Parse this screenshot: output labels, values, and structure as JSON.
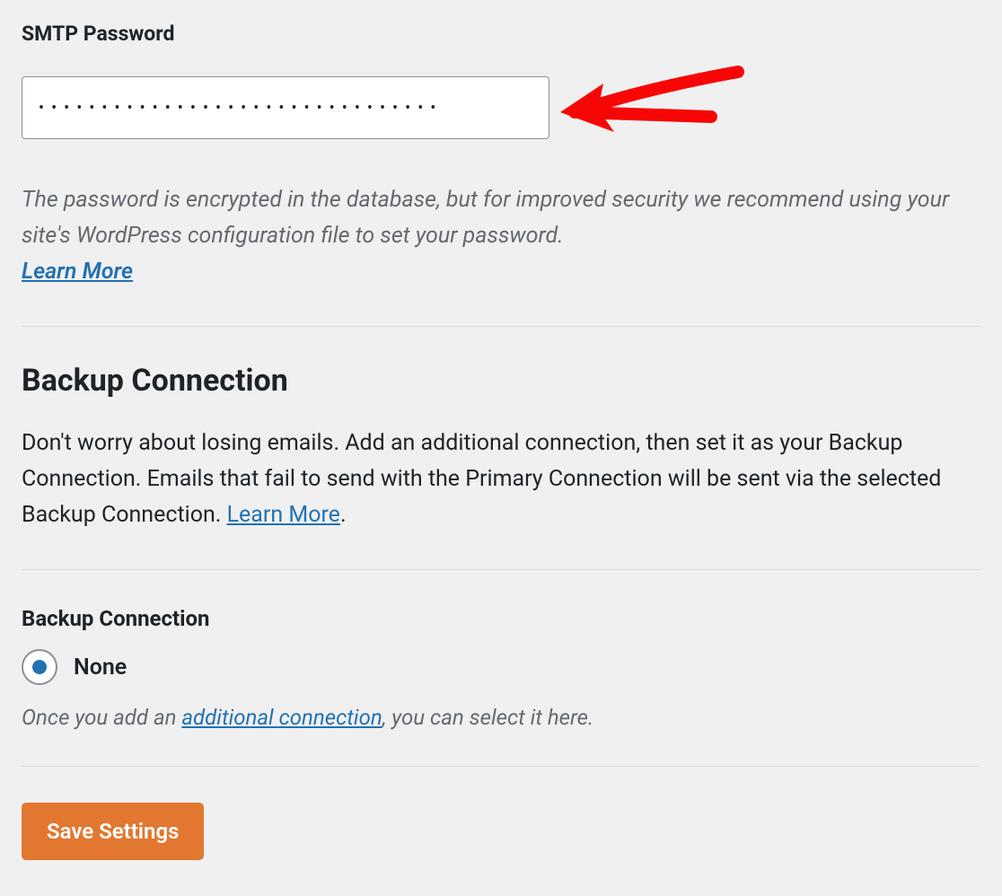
{
  "smtp": {
    "label": "SMTP Password",
    "value": "••••••••••••••••••••••••••••••••",
    "help_text": "The password is encrypted in the database, but for improved security we recommend using your site's WordPress configuration file to set your password.",
    "learn_more": "Learn More"
  },
  "backup": {
    "heading": "Backup Connection",
    "description_pre": "Don't worry about losing emails. Add an additional connection, then set it as your Backup Connection. Emails that fail to send with the Primary Connection will be sent via the selected Backup Connection. ",
    "description_link": "Learn More",
    "description_post": ".",
    "field_label": "Backup Connection",
    "option_none": "None",
    "help_pre": "Once you add an ",
    "help_link": "additional connection",
    "help_post": ", you can select it here."
  },
  "actions": {
    "save": "Save Settings"
  }
}
